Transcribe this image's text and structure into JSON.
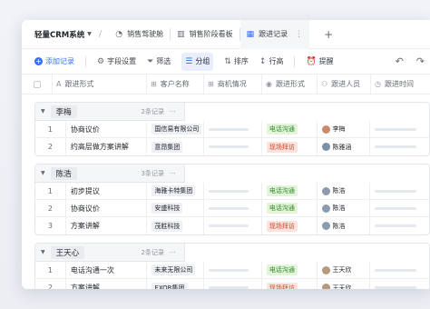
{
  "app": {
    "title": "轻量CRM系统"
  },
  "tabs": [
    {
      "label": "销售驾驶舱",
      "icon": "dashboard-icon"
    },
    {
      "label": "销售阶段看板",
      "icon": "kanban-icon"
    },
    {
      "label": "跟进记录",
      "icon": "table-icon",
      "active": true
    }
  ],
  "toolbar": {
    "add_label": "添加记录",
    "field_label": "字段设置",
    "filter_label": "筛选",
    "group_label": "分组",
    "sort_label": "排序",
    "row_height_label": "行高",
    "reminder_label": "提醒"
  },
  "columns": {
    "title": "跟进形式",
    "customer": "客户名称",
    "opportunity": "商机情况",
    "method": "跟进形式",
    "person": "跟进人员",
    "time": "跟进时间"
  },
  "colors": {
    "accent": "#3370ff",
    "phone_bg": "#e3f4d9",
    "phone_fg": "#2f8b2f",
    "visit_bg": "#fde3dc",
    "visit_fg": "#d2452f"
  },
  "groups": [
    {
      "name": "李梅",
      "count": "2条记录",
      "rows": [
        {
          "num": "1",
          "title": "协商议价",
          "customer": "国信易有限公司",
          "method": "电话沟通",
          "method_type": "phone",
          "person": "李梅",
          "avatar": "#c98b6b"
        },
        {
          "num": "2",
          "title": "约高层做方案讲解",
          "customer": "意昂集团",
          "method": "现场拜访",
          "method_type": "visit",
          "person": "陈雅涵",
          "avatar": "#7b8fa6"
        }
      ]
    },
    {
      "name": "陈浩",
      "count": "3条记录",
      "rows": [
        {
          "num": "1",
          "title": "初步提议",
          "customer": "海雅卡特集团",
          "method": "电话沟通",
          "method_type": "phone",
          "person": "陈浩",
          "avatar": "#8c9bb0"
        },
        {
          "num": "2",
          "title": "协商议价",
          "customer": "安盛科技",
          "method": "电话沟通",
          "method_type": "phone",
          "person": "陈浩",
          "avatar": "#8c9bb0"
        },
        {
          "num": "3",
          "title": "方案讲解",
          "customer": "茂胜科技",
          "method": "现场拜访",
          "method_type": "visit",
          "person": "陈浩",
          "avatar": "#8c9bb0"
        }
      ]
    },
    {
      "name": "王天心",
      "count": "2条记录",
      "rows": [
        {
          "num": "1",
          "title": "电话沟通一次",
          "customer": "未来无限公司",
          "method": "电话沟通",
          "method_type": "phone",
          "person": "王天欣",
          "avatar": "#b59a7e"
        },
        {
          "num": "2",
          "title": "方案讲解",
          "customer": "EXOR集团",
          "method": "现场拜访",
          "method_type": "visit",
          "person": "王天欣",
          "avatar": "#b59a7e"
        }
      ]
    }
  ]
}
